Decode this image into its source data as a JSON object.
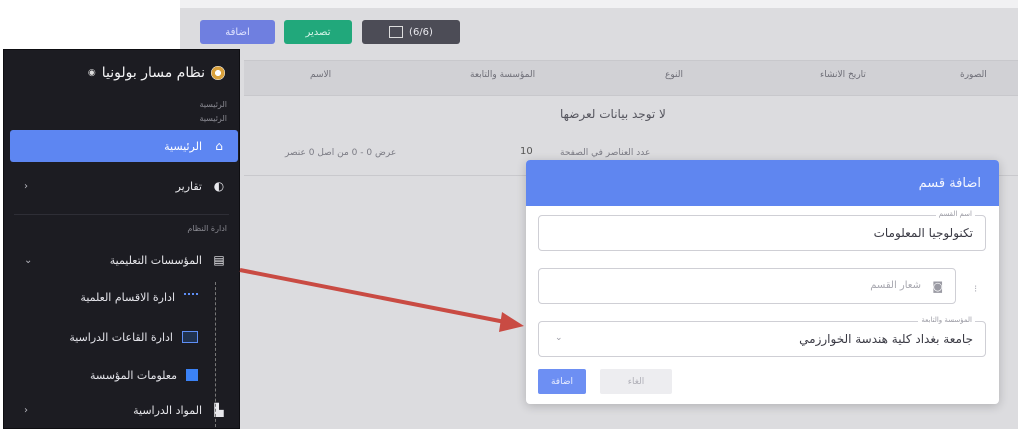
{
  "toolbar": {
    "add_label": "اضافة",
    "export_label": "تصدير",
    "columns_label": "(6/6)"
  },
  "table": {
    "headers": [
      "الاسم",
      "المؤسسة والتابعة",
      "النوع",
      "تاريخ الانشاء",
      "الصورة"
    ],
    "empty_message": "لا توجد بيانات لعرضها",
    "pager_left": "عرض 0 - 0 من اصل 0 عنصر",
    "pager_right": "عدد العناصر في الصفحة",
    "page_size": "10"
  },
  "sidebar": {
    "title": "نظام مسار بولونيا",
    "section_main": "الرئيسية",
    "section_manage": "ادارة النظام",
    "items": [
      {
        "label": "الرئيسية",
        "icon": "home-icon",
        "active": true
      },
      {
        "label": "تقارير",
        "icon": "pie-chart-icon",
        "active": false
      },
      {
        "label": "المؤسسات التعليمية",
        "icon": "building-icon",
        "active": false,
        "expanded": true
      },
      {
        "label": "ادارة الاقسام العلمية",
        "icon": "network-icon",
        "active": false
      },
      {
        "label": "ادارة القاعات الدراسية",
        "icon": "screen-icon",
        "active": false
      },
      {
        "label": "معلومات المؤسسة",
        "icon": "info-icon",
        "active": false
      },
      {
        "label": "المواد الدراسية",
        "icon": "book-icon",
        "active": false
      }
    ]
  },
  "modal": {
    "title": "اضافة قسم",
    "name_label": "اسم القسم",
    "name_value": "تكنولوجيا المعلومات",
    "logo_placeholder": "شعار القسم",
    "institution_label": "المؤسسة والتابعة",
    "institution_value": "جامعة بغداد كلية هندسة الخوارزمي",
    "save_label": "اضافة",
    "cancel_label": "الغاء"
  },
  "colors": {
    "accent": "#5f86f0",
    "export": "#21a87b",
    "sidebar_bg": "#1c1c22",
    "arrow": "#c94b43"
  }
}
